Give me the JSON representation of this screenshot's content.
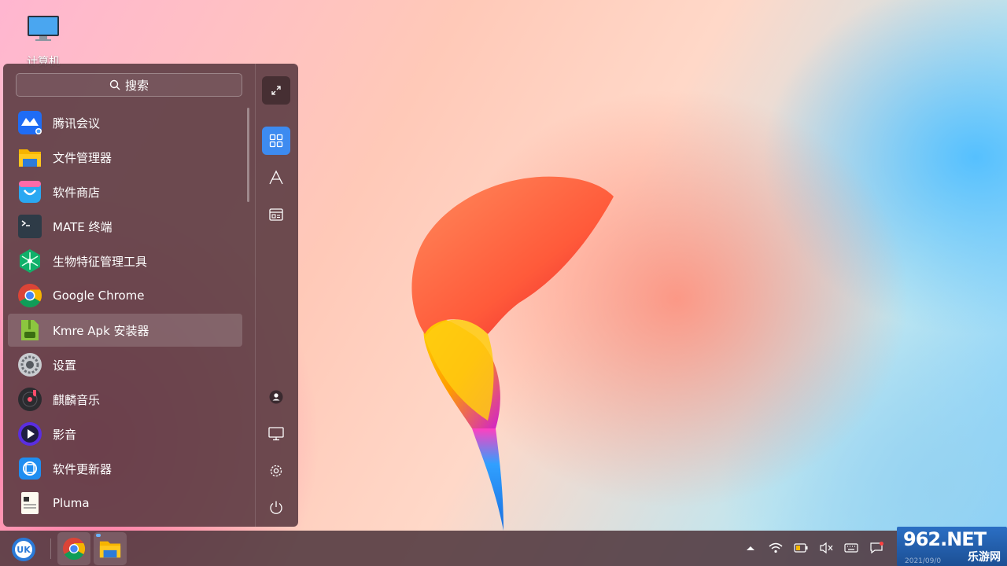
{
  "desktop": {
    "icons": [
      {
        "label": "计算机",
        "icon": "computer-icon"
      }
    ]
  },
  "start_menu": {
    "search": {
      "placeholder": "搜索",
      "icon": "search-icon"
    },
    "apps": [
      {
        "label": "腾讯会议",
        "icon": "tencent-meeting-icon"
      },
      {
        "label": "文件管理器",
        "icon": "file-manager-icon"
      },
      {
        "label": "软件商店",
        "icon": "software-store-icon"
      },
      {
        "label": "MATE 终端",
        "icon": "terminal-icon"
      },
      {
        "label": "生物特征管理工具",
        "icon": "biometric-icon"
      },
      {
        "label": "Google Chrome",
        "icon": "chrome-icon"
      },
      {
        "label": "Kmre Apk 安装器",
        "icon": "apk-installer-icon",
        "selected": true
      },
      {
        "label": "设置",
        "icon": "settings-icon"
      },
      {
        "label": "麒麟音乐",
        "icon": "music-icon"
      },
      {
        "label": "影音",
        "icon": "video-player-icon"
      },
      {
        "label": "软件更新器",
        "icon": "software-updater-icon"
      },
      {
        "label": "Pluma",
        "icon": "pluma-icon"
      }
    ],
    "sidebar": {
      "expand": "expand-icon",
      "views": [
        "grid-view-icon",
        "alphabet-view-icon",
        "category-view-icon"
      ],
      "active_view": "grid-view-icon",
      "bottom": [
        "user-icon",
        "monitor-icon",
        "gear-icon",
        "power-icon"
      ]
    }
  },
  "taskbar": {
    "start": "kylin-start-icon",
    "apps": [
      "chrome-icon",
      "file-manager-icon"
    ],
    "tray": [
      "arrow-up-icon",
      "wifi-icon",
      "battery-icon",
      "volume-muted-icon",
      "keyboard-icon",
      "notification-icon"
    ]
  },
  "watermark": {
    "brand": "962.NET",
    "sub": "乐游网",
    "date": "2021/09/0"
  },
  "colors": {
    "accent": "#3d8bf0",
    "menu_bg": "#5c3c42"
  }
}
